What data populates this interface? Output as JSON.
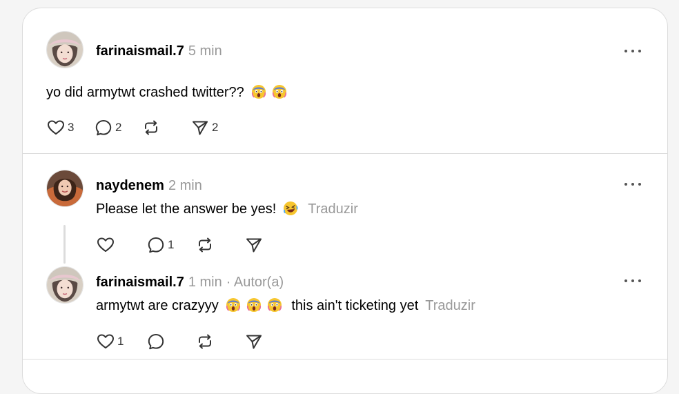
{
  "posts": [
    {
      "username": "farinaismail.7",
      "time": "5 min",
      "text": "yo did armytwt crashed twitter??",
      "emojis": [
        "screaming-face-emoji",
        "screaming-face-emoji"
      ],
      "likes": "3",
      "replies": "2",
      "reposts": "",
      "shares": "2"
    },
    {
      "username": "naydenem",
      "time": "2 min",
      "text": "Please let the answer be yes!",
      "emojis": [
        "rolling-laughing-face-emoji"
      ],
      "translate": "Traduzir",
      "likes": "",
      "replies": "1",
      "reposts": "",
      "shares": ""
    },
    {
      "username": "farinaismail.7",
      "time": "1 min",
      "author_badge": "· Autor(a)",
      "text_before": "armytwt are crazyyy",
      "emojis": [
        "screaming-face-emoji",
        "screaming-face-emoji",
        "screaming-face-emoji"
      ],
      "text_after": "this ain't ticketing yet",
      "translate": "Traduzir",
      "likes": "1",
      "replies": "",
      "reposts": "",
      "shares": ""
    }
  ],
  "icons": {
    "like": "heart-icon",
    "reply": "comment-bubble-icon",
    "repost": "repost-icon",
    "share": "send-icon",
    "more": "more-dots-icon"
  },
  "colors": {
    "muted_text": "#999999",
    "divider": "#dcdcdc",
    "icon": "#333333"
  }
}
